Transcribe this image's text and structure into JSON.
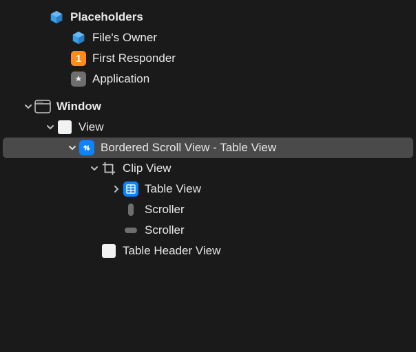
{
  "placeholders": {
    "header": "Placeholders",
    "items": [
      {
        "label": "File's Owner",
        "icon": "cube-icon"
      },
      {
        "label": "First Responder",
        "icon": "one-badge-icon",
        "badge_text": "1"
      },
      {
        "label": "Application",
        "icon": "app-icon"
      }
    ]
  },
  "objects": {
    "window": {
      "label": "Window"
    },
    "view": {
      "label": "View"
    },
    "scrollview": {
      "label": "Bordered Scroll View - Table View"
    },
    "clipview": {
      "label": "Clip View"
    },
    "tableview": {
      "label": "Table View"
    },
    "scroller1": {
      "label": "Scroller"
    },
    "scroller2": {
      "label": "Scroller"
    },
    "tableheader": {
      "label": "Table Header View"
    }
  }
}
